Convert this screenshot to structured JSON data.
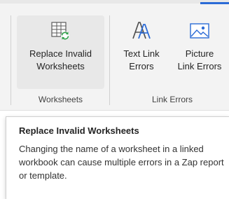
{
  "ribbon": {
    "accent_color": "#2b6bd6",
    "groups": [
      {
        "label": "Worksheets",
        "buttons": [
          {
            "label": "Replace Invalid\nWorksheets",
            "icon": "replace-invalid-worksheets-icon"
          }
        ]
      },
      {
        "label": "Link Errors",
        "buttons": [
          {
            "label": "Text Link\nErrors",
            "icon": "text-link-errors-icon"
          },
          {
            "label": "Picture\nLink Errors",
            "icon": "picture-link-errors-icon"
          }
        ]
      }
    ]
  },
  "tooltip": {
    "title": "Replace Invalid Worksheets",
    "body": "Changing the name of a worksheet in a linked workbook can cause multiple errors in a Zap report or template."
  }
}
